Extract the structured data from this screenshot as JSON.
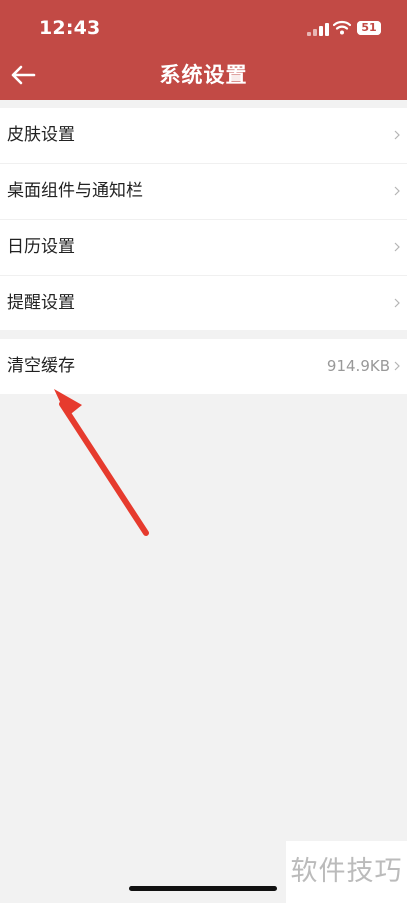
{
  "status_bar": {
    "time": "12:43",
    "battery": "51",
    "icons": [
      "signal-icon",
      "wifi-icon",
      "battery-icon"
    ]
  },
  "header": {
    "title": "系统设置",
    "back_icon": "back-arrow-icon"
  },
  "settings_group_1": [
    {
      "label": "皮肤设置"
    },
    {
      "label": "桌面组件与通知栏"
    },
    {
      "label": "日历设置"
    },
    {
      "label": "提醒设置"
    }
  ],
  "settings_group_2": [
    {
      "label": "清空缓存",
      "value": "914.9KB"
    }
  ],
  "watermark": "软件技巧",
  "colors": {
    "header_bg": "#c24a45",
    "page_bg": "#f2f2f2",
    "annotation_arrow": "#e63b2e"
  }
}
